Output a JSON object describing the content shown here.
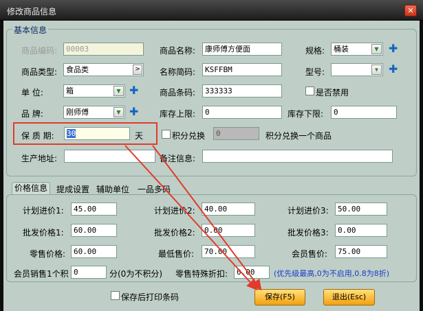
{
  "window": {
    "title": "修改商品信息",
    "close_symbol": "✕"
  },
  "basic": {
    "group_title": "基本信息",
    "code_label": "商品编码:",
    "code_value": "00003",
    "name_label": "商品名称:",
    "name_value": "康师傅方便面",
    "spec_label": "规格:",
    "spec_value": "桶装",
    "type_label": "商品类型:",
    "type_value": "食品类",
    "short_label": "名称简码:",
    "short_value": "KSFFBM",
    "model_label": "型号:",
    "model_value": "",
    "unit_label": "单      位:",
    "unit_value": "箱",
    "barcode_label": "商品条码:",
    "barcode_value": "333333",
    "disabled_label": "是否禁用",
    "brand_label": "品      牌:",
    "brand_value": "刚师傅",
    "stock_upper_label": "库存上限:",
    "stock_upper_value": "0",
    "stock_lower_label": "库存下限:",
    "stock_lower_value": "0",
    "shelf_label": "保 质 期:",
    "shelf_value": "30",
    "shelf_unit": "天",
    "points_label": "积分兑换",
    "points_value": "0",
    "points_suffix": "积分兑换一个商品",
    "address_label": "生产地址:",
    "address_value": "",
    "remark_label": "备注信息:",
    "remark_value": ""
  },
  "tabs": [
    "价格信息",
    "提成设置",
    "辅助单位",
    "一品多码"
  ],
  "prices": {
    "plan1_label": "计划进价1:",
    "plan1_value": "45.00",
    "plan2_label": "计划进价2:",
    "plan2_value": "40.00",
    "plan3_label": "计划进价3:",
    "plan3_value": "50.00",
    "whole1_label": "批发价格1:",
    "whole1_value": "60.00",
    "whole2_label": "批发价格2:",
    "whole2_value": "0.00",
    "whole3_label": "批发价格3:",
    "whole3_value": "0.00",
    "retail_label": "零售价格:",
    "retail_value": "60.00",
    "min_label": "最低售价:",
    "min_value": "70.00",
    "member_label": "会员售价:",
    "member_value": "75.00",
    "member_points_label": "会员销售1个积",
    "member_points_value": "0",
    "member_points_suffix": "分(0为不积分)",
    "discount_label": "零售特殊折扣:",
    "discount_value": "0.00",
    "discount_note": "(优先级最高,0为不启用,0.8为8折)"
  },
  "footer": {
    "print_label": "保存后打印条码",
    "save_label": "保存(F5)",
    "exit_label": "退出(Esc)"
  },
  "colors": {
    "accent_arrow": "#e23a2b",
    "button": "#f4a00e",
    "background": "#bfcfc8",
    "plus_icon": "#1565c0"
  }
}
